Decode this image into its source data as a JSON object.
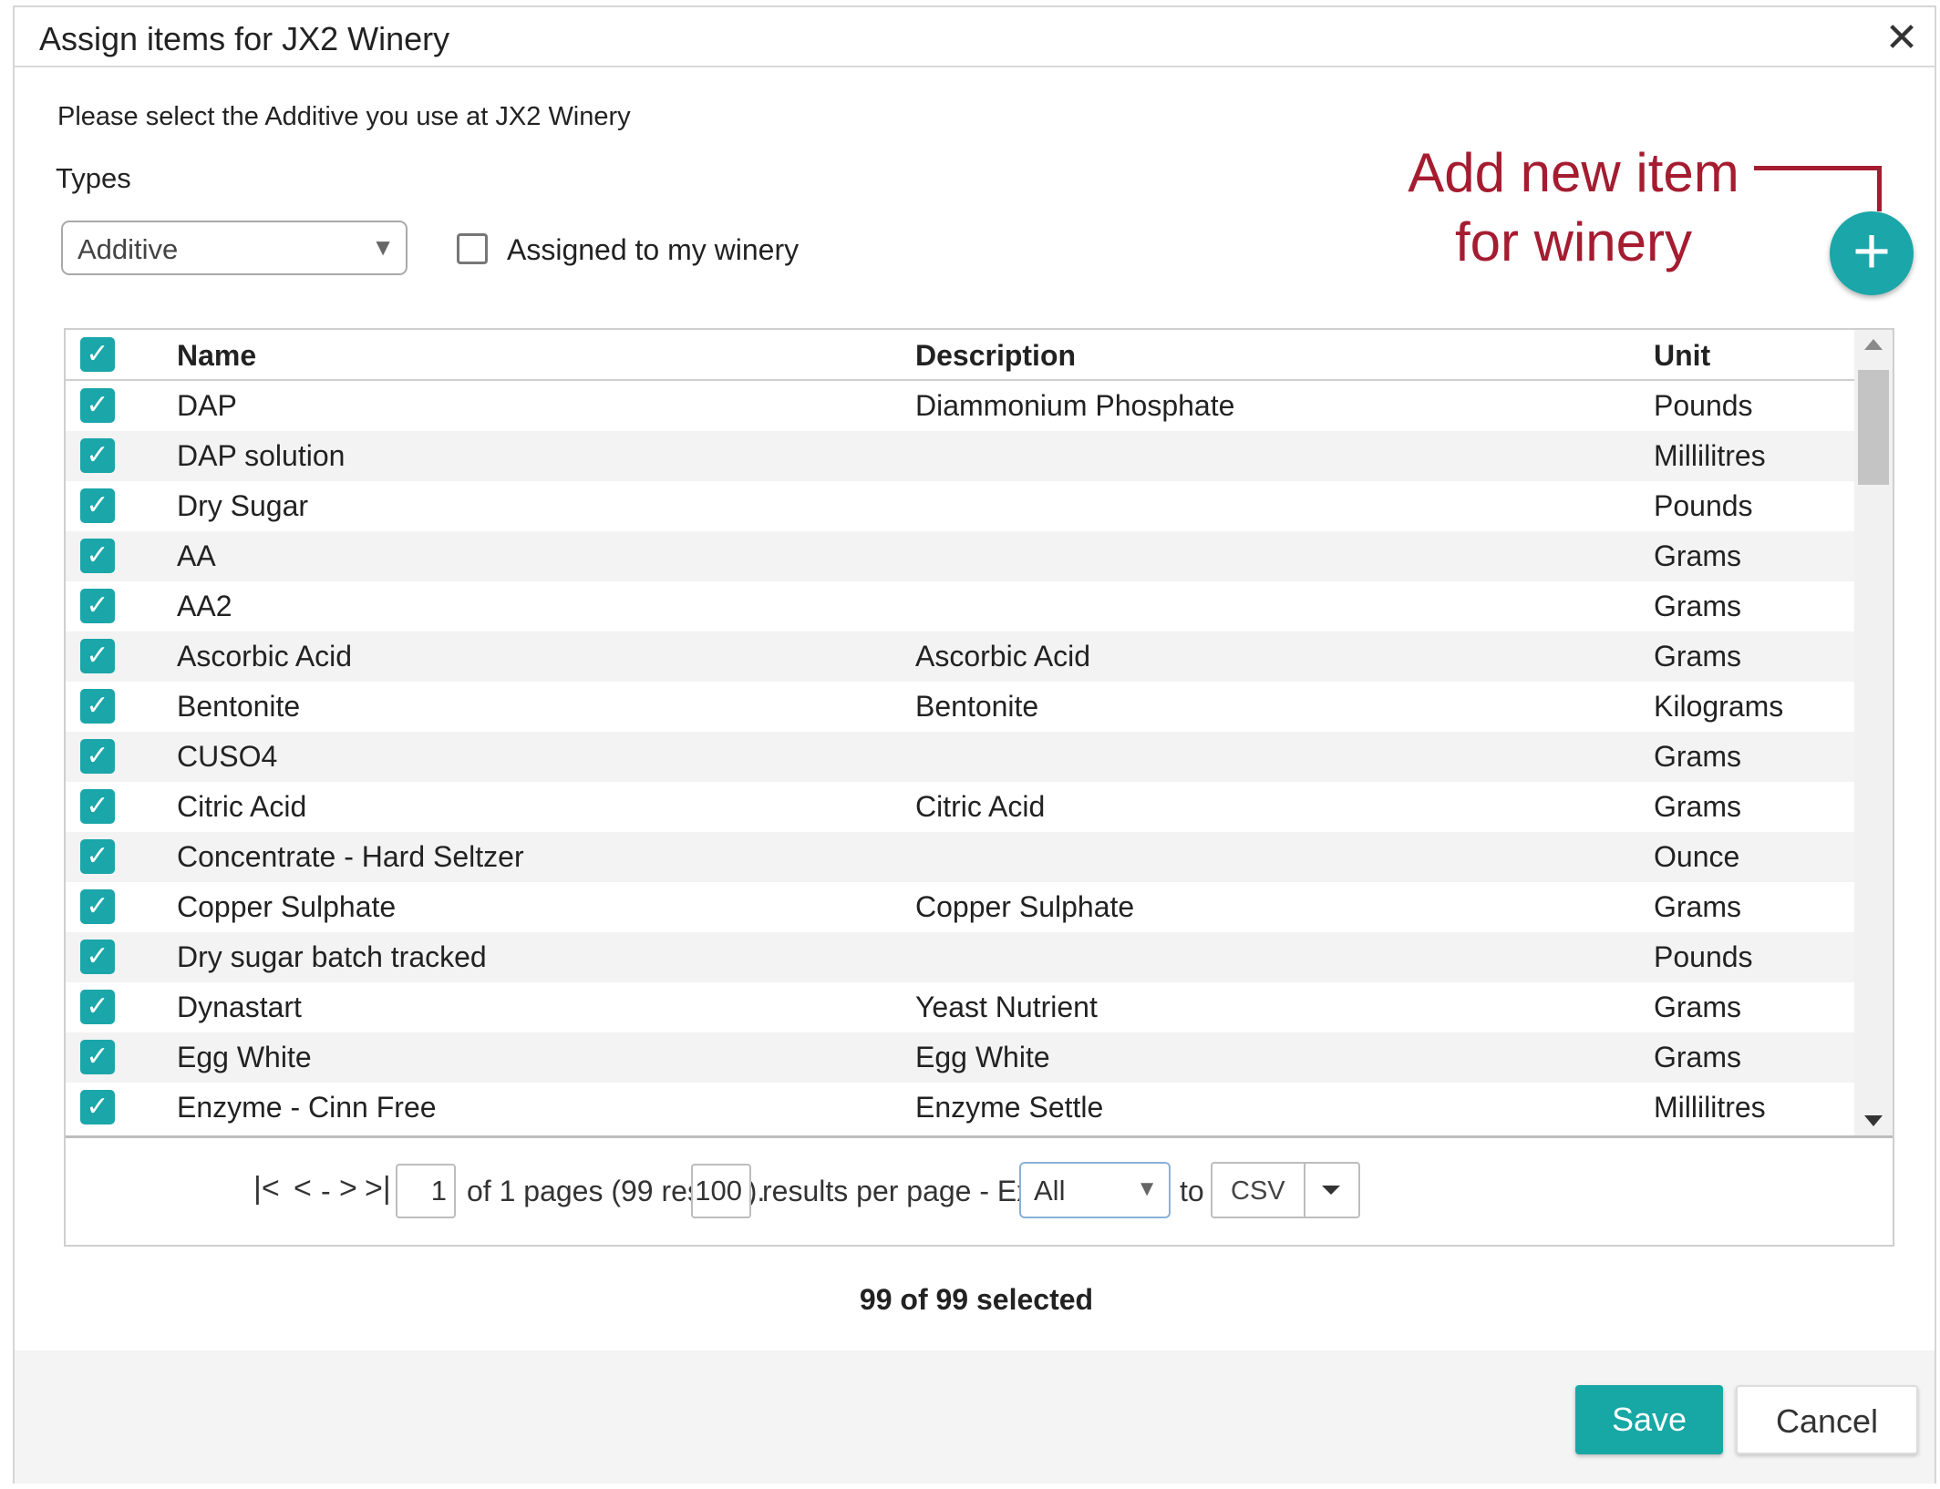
{
  "dialog": {
    "title": "Assign items for JX2 Winery",
    "close_label": "✕",
    "intro": "Please select the Additive you use at JX2 Winery",
    "types_label": "Types",
    "type_selected": "Additive",
    "assigned_label": "Assigned to my winery"
  },
  "annotation": {
    "line1": "Add new item",
    "line2": "for winery",
    "add_button_label": "+",
    "color": "#a51c30"
  },
  "grid": {
    "columns": [
      "Name",
      "Description",
      "Unit"
    ],
    "rows": [
      {
        "name": "DAP",
        "description": "Diammonium Phosphate",
        "unit": "Pounds"
      },
      {
        "name": "DAP solution",
        "description": "",
        "unit": "Millilitres"
      },
      {
        "name": "Dry Sugar",
        "description": "",
        "unit": "Pounds"
      },
      {
        "name": "AA",
        "description": "",
        "unit": "Grams"
      },
      {
        "name": "AA2",
        "description": "",
        "unit": "Grams"
      },
      {
        "name": "Ascorbic Acid",
        "description": "Ascorbic Acid",
        "unit": "Grams"
      },
      {
        "name": "Bentonite",
        "description": "Bentonite",
        "unit": "Kilograms"
      },
      {
        "name": "CUSO4",
        "description": "",
        "unit": "Grams"
      },
      {
        "name": "Citric Acid",
        "description": "Citric Acid",
        "unit": "Grams"
      },
      {
        "name": "Concentrate - Hard Seltzer",
        "description": "",
        "unit": "Ounce"
      },
      {
        "name": "Copper Sulphate",
        "description": "Copper Sulphate",
        "unit": "Grams"
      },
      {
        "name": "Dry sugar batch tracked",
        "description": "",
        "unit": "Pounds"
      },
      {
        "name": "Dynastart",
        "description": "Yeast Nutrient",
        "unit": "Grams"
      },
      {
        "name": "Egg White",
        "description": "Egg White",
        "unit": "Grams"
      },
      {
        "name": "Enzyme - Cinn Free",
        "description": "Enzyme Settle",
        "unit": "Millilitres"
      }
    ]
  },
  "pager": {
    "first": "|<",
    "prev": "<",
    "dash": "-",
    "next": ">",
    "last": ">|",
    "page": "1",
    "pages_text": "of 1 pages (99 results).",
    "per_page": "100",
    "per_page_text": "results per page - Export",
    "export_scope": "All",
    "to_text": "to",
    "format": "CSV"
  },
  "selection": {
    "count_text": "99 of 99 selected"
  },
  "footer": {
    "save_label": "Save",
    "cancel_label": "Cancel"
  },
  "colors": {
    "accent": "#1ba6a9",
    "annotation": "#a51c30"
  }
}
